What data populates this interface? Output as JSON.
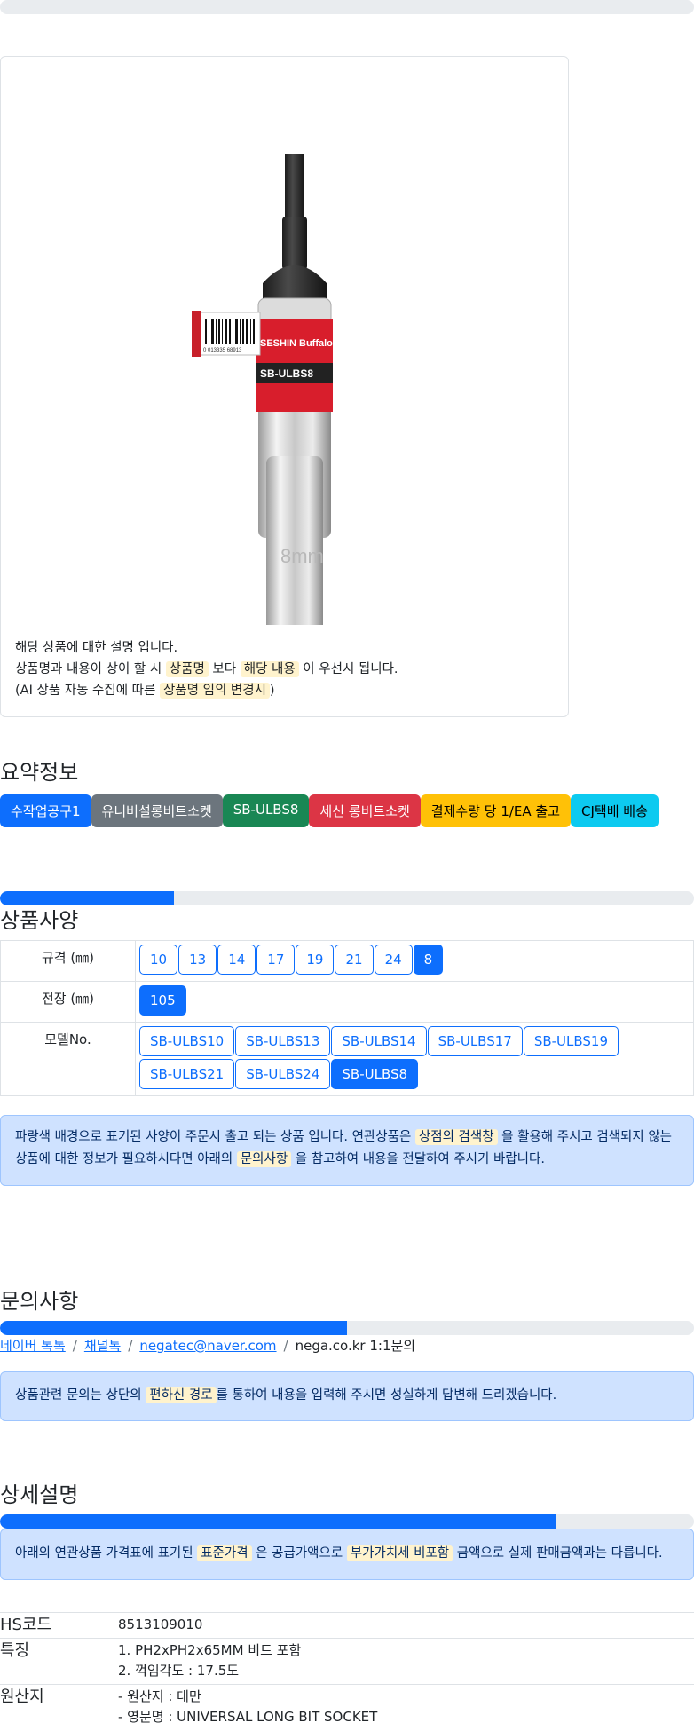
{
  "top_progress": {
    "percent": 0
  },
  "product": {
    "image_label": "SB-ULBS8",
    "brand_label": "SESHIN Buffalo",
    "barcode_text": "0 013335 68913",
    "socket_mark": "8mm",
    "desc_line1": "해당 상품에 대한 설명 입니다.",
    "desc_line2_a": "상품명과 내용이 상이 할 시 ",
    "desc_line2_mark1": "상품명",
    "desc_line2_b": " 보다 ",
    "desc_line2_mark2": "해당 내용",
    "desc_line2_c": " 이 우선시 됩니다.",
    "desc_line3_a": "(AI 상품 자동 수집에 따른 ",
    "desc_line3_mark": "상품명 임의 변경시",
    "desc_line3_b": ")"
  },
  "summary": {
    "title": "요약정보",
    "badges": [
      {
        "label": "수작업공구1",
        "color": "#0d6efd",
        "text_color": "#ffffff"
      },
      {
        "label": "유니버설롱비트소켓",
        "color": "#6c757d",
        "text_color": "#ffffff"
      },
      {
        "label": "SB-ULBS8",
        "color": "#198754",
        "text_color": "#ffffff"
      },
      {
        "label": "세신 롱비트소켓",
        "color": "#dc3545",
        "text_color": "#ffffff"
      },
      {
        "label": "결제수량 당 1/EA 출고",
        "color": "#ffc107",
        "text_color": "#000000"
      },
      {
        "label": "CJ택배 배송",
        "color": "#0dcaf0",
        "text_color": "#000000"
      }
    ]
  },
  "spec": {
    "progress_percent": 25,
    "title": "상품사양",
    "rows": [
      {
        "label": "규격 (㎜)",
        "options": [
          "10",
          "13",
          "14",
          "17",
          "19",
          "21",
          "24",
          "8"
        ],
        "active": "8"
      },
      {
        "label": "전장 (㎜)",
        "options": [
          "105"
        ],
        "active": "105"
      },
      {
        "label": "모델No.",
        "options": [
          "SB-ULBS10",
          "SB-ULBS13",
          "SB-ULBS14",
          "SB-ULBS17",
          "SB-ULBS19",
          "SB-ULBS21",
          "SB-ULBS24",
          "SB-ULBS8"
        ],
        "active": "SB-ULBS8"
      }
    ],
    "notice_a": "파랑색 배경으로 표기된 사양이 주문시 출고 되는 상품 입니다. 연관상품은 ",
    "notice_mark1": "상점의 검색창",
    "notice_b": " 을 활용해 주시고 검색되지 않는 상품에 대한 정보가 필요하시다면 아래의 ",
    "notice_mark2": "문의사항",
    "notice_c": " 을 참고하여 내용을 전달하여 주시기 바랍니다."
  },
  "inquiry": {
    "title": "문의사항",
    "progress_percent": 50,
    "links": [
      "네이버 톡톡",
      "채널톡",
      "negatec@naver.com"
    ],
    "plain": "nega.co.kr 1:1문의",
    "notice_a": "상품관련 문의는 상단의 ",
    "notice_mark": "편하신 경로",
    "notice_b": "를 통하여 내용을 입력해 주시면 성실하게 답변해 드리겠습니다."
  },
  "detail": {
    "title": "상세설명",
    "progress_percent": 80,
    "notice_a": "아래의 연관상품 가격표에 표기된 ",
    "notice_mark1": "표준가격",
    "notice_b": " 은 공급가액으로 ",
    "notice_mark2": "부가가치세 비포함",
    "notice_c": " 금액으로 실제 판매금액과는 다릅니다.",
    "rows": [
      {
        "key": "HS코드",
        "lines": [
          "8513109010"
        ]
      },
      {
        "key": "특징",
        "lines": [
          "1. PH2xPH2x65MM 비트 포함",
          "2. 꺽임각도 : 17.5도"
        ]
      },
      {
        "key": "원산지",
        "lines": [
          "- 원산지 : 대만",
          "- 영문명 : UNIVERSAL LONG BIT SOCKET"
        ]
      }
    ]
  }
}
